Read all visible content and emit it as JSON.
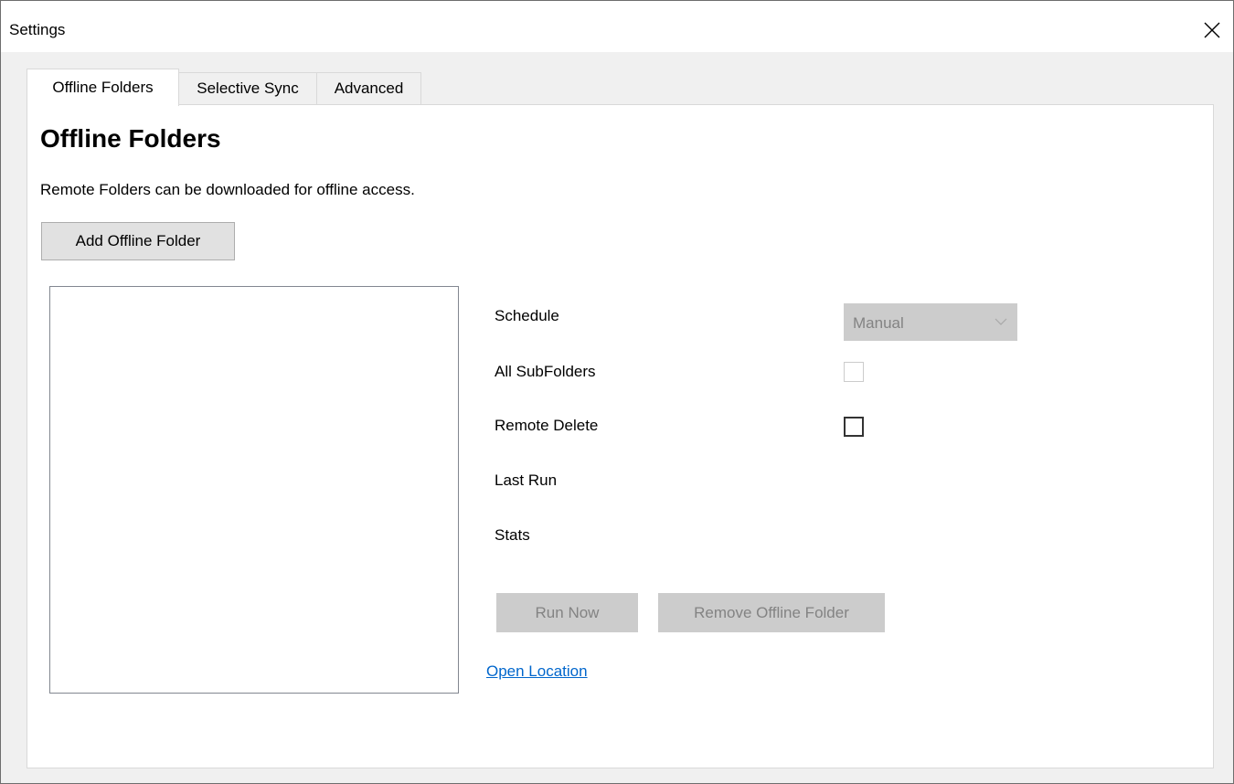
{
  "window": {
    "title": "Settings"
  },
  "tabs": [
    {
      "label": "Offline Folders",
      "active": true
    },
    {
      "label": "Selective Sync",
      "active": false
    },
    {
      "label": "Advanced",
      "active": false
    }
  ],
  "panel": {
    "heading": "Offline Folders",
    "description": "Remote Folders can be downloaded for offline access.",
    "add_button": "Add Offline Folder",
    "folder_list": [],
    "details": {
      "schedule_label": "Schedule",
      "schedule_value": "Manual",
      "all_subfolders_label": "All SubFolders",
      "all_subfolders_checked": false,
      "remote_delete_label": "Remote Delete",
      "remote_delete_checked": false,
      "last_run_label": "Last Run",
      "stats_label": "Stats"
    },
    "run_now_button": "Run Now",
    "remove_button": "Remove Offline Folder",
    "open_location_link": "Open Location"
  },
  "icons": {
    "close": "close-icon",
    "dropdown": "chevron-down-icon"
  },
  "colors": {
    "link": "#0066cc",
    "disabled_bg": "#cccccc",
    "disabled_text": "#838383"
  }
}
